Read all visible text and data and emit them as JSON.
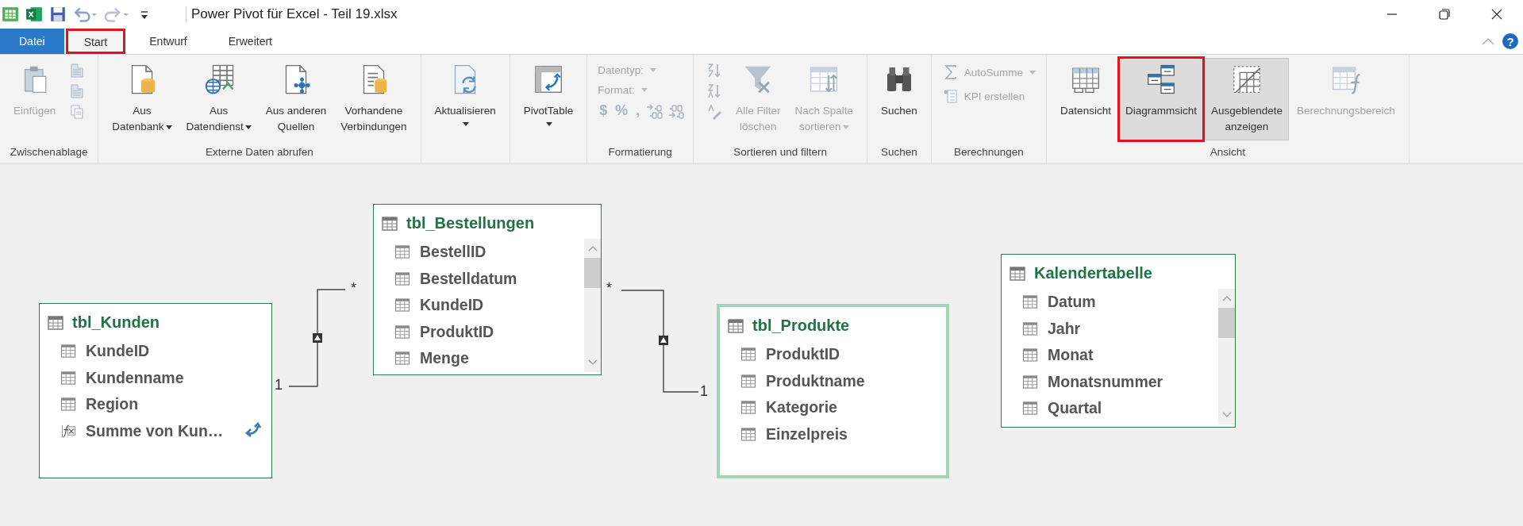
{
  "window": {
    "title": "Power Pivot für Excel - Teil 19.xlsx"
  },
  "tabs": [
    {
      "label": "Datei",
      "kind": "file",
      "selected": false,
      "highlighted": false
    },
    {
      "label": "Start",
      "kind": "tab",
      "selected": true,
      "highlighted": true
    },
    {
      "label": "Entwurf",
      "kind": "tab",
      "selected": false,
      "highlighted": false
    },
    {
      "label": "Erweitert",
      "kind": "tab",
      "selected": false,
      "highlighted": false
    }
  ],
  "help": "?",
  "ribbon_groups": [
    {
      "label": "Zwischenablage",
      "items": [
        {
          "kind": "large",
          "lines": [
            "Einfügen"
          ],
          "disabled": true
        },
        {
          "kind": "icons"
        }
      ]
    },
    {
      "label": "Externe Daten abrufen",
      "items": [
        {
          "kind": "large",
          "lines": [
            "Aus",
            "Datenbank"
          ],
          "disabled": false,
          "dropdown": true
        },
        {
          "kind": "large",
          "lines": [
            "Aus",
            "Datendienst"
          ],
          "disabled": false,
          "dropdown": true
        },
        {
          "kind": "large",
          "lines": [
            "Aus anderen",
            "Quellen"
          ],
          "disabled": false
        },
        {
          "kind": "large",
          "lines": [
            "Vorhandene",
            "Verbindungen"
          ],
          "disabled": false
        }
      ]
    },
    {
      "items": [
        {
          "kind": "large",
          "lines": [
            "Aktualisieren"
          ],
          "disabled": false,
          "dropdown": true
        }
      ]
    },
    {
      "items": [
        {
          "kind": "large",
          "lines": [
            "PivotTable"
          ],
          "disabled": false,
          "dropdown": true
        }
      ]
    },
    {
      "label": "Formatierung",
      "items": [
        {
          "kind": "stack",
          "items": [
            {
              "kind": "field",
              "label": "Datentyp:",
              "disabled": true
            },
            {
              "kind": "field",
              "label": "Format:",
              "disabled": true
            },
            {
              "kind": "symbols",
              "symbols": [
                "$",
                "%",
                ","
              ],
              "disabled": true
            }
          ]
        }
      ]
    },
    {
      "label": "Sortieren und filtern",
      "items": [
        {
          "kind": "icons"
        },
        {
          "kind": "large",
          "lines": [
            "Alle Filter",
            "löschen"
          ],
          "disabled": true
        },
        {
          "kind": "large",
          "lines": [
            "Nach Spalte",
            "sortieren"
          ],
          "disabled": true,
          "dropdown": true
        }
      ]
    },
    {
      "label": "Suchen",
      "items": [
        {
          "kind": "large",
          "lines": [
            "Suchen"
          ],
          "disabled": false
        }
      ]
    },
    {
      "label": "Berechnungen",
      "items": [
        {
          "kind": "stack",
          "items": [
            {
              "kind": "small",
              "label": "AutoSumme",
              "disabled": true,
              "dropdown": true
            },
            {
              "kind": "small",
              "label": "KPI erstellen",
              "disabled": true
            }
          ]
        }
      ]
    },
    {
      "label": "Ansicht",
      "items": [
        {
          "kind": "large",
          "lines": [
            "Datensicht"
          ],
          "disabled": false,
          "selected": false,
          "highlighted": false
        },
        {
          "kind": "large",
          "lines": [
            "Diagrammsicht"
          ],
          "disabled": false,
          "selected": true,
          "highlighted": true
        },
        {
          "kind": "large",
          "lines": [
            "Ausgeblendete",
            "anzeigen"
          ],
          "disabled": false,
          "selected": true,
          "highlighted": false
        },
        {
          "kind": "large",
          "lines": [
            "Berechnungsbereich"
          ],
          "disabled": true,
          "selected": false,
          "highlighted": false
        }
      ]
    }
  ],
  "diagram": {
    "tables": [
      {
        "name": "tbl_Kunden",
        "selected": false,
        "scrollable": false,
        "fields": [
          {
            "name": "KundeID",
            "kind": "column"
          },
          {
            "name": "Kundenname",
            "kind": "column"
          },
          {
            "name": "Region",
            "kind": "column"
          },
          {
            "name": "Summe von Kun…",
            "kind": "measure"
          }
        ]
      },
      {
        "name": "tbl_Bestellungen",
        "selected": false,
        "scrollable": true,
        "fields": [
          {
            "name": "BestellID",
            "kind": "column"
          },
          {
            "name": "Bestelldatum",
            "kind": "column"
          },
          {
            "name": "KundeID",
            "kind": "column"
          },
          {
            "name": "ProduktID",
            "kind": "column"
          },
          {
            "name": "Menge",
            "kind": "column"
          }
        ]
      },
      {
        "name": "tbl_Produkte",
        "selected": true,
        "scrollable": false,
        "fields": [
          {
            "name": "ProduktID",
            "kind": "column"
          },
          {
            "name": "Produktname",
            "kind": "column"
          },
          {
            "name": "Kategorie",
            "kind": "column"
          },
          {
            "name": "Einzelpreis",
            "kind": "column"
          }
        ]
      },
      {
        "name": "Kalendertabelle",
        "selected": false,
        "scrollable": true,
        "fields": [
          {
            "name": "Datum",
            "kind": "column"
          },
          {
            "name": "Jahr",
            "kind": "column"
          },
          {
            "name": "Monat",
            "kind": "column"
          },
          {
            "name": "Monatsnummer",
            "kind": "column"
          },
          {
            "name": "Quartal",
            "kind": "column"
          }
        ]
      }
    ],
    "relationships": [
      {
        "one_label": "1",
        "many_label": "*"
      },
      {
        "one_label": "1",
        "many_label": "*"
      }
    ]
  }
}
